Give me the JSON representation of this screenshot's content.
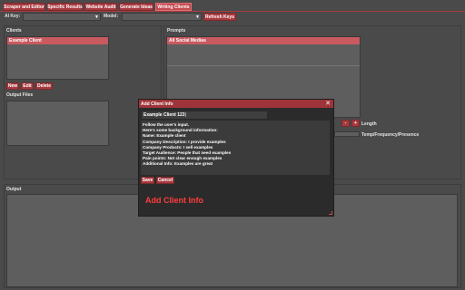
{
  "tabs": [
    "Scraper and Editor",
    "Specific Results",
    "Website Audit",
    "Generate Ideas",
    "Writing Clients"
  ],
  "topbar": {
    "ai_key_label": "AI Key:",
    "ai_key_value": "",
    "model_label": "Model:",
    "model_value": "",
    "refresh_label": "Refresh Keys"
  },
  "clients": {
    "title": "Clients",
    "items": [
      "Example Client"
    ],
    "new_label": "New",
    "edit_label": "Edit",
    "delete_label": "Delete"
  },
  "output_files": {
    "title": "Output Files"
  },
  "prompts": {
    "title": "Prompts",
    "items": [
      "All Social Medias"
    ],
    "minus_label": "-",
    "plus_label": "+",
    "length_label": "Length",
    "temp_label": "Temp/Frequency/Presence"
  },
  "output": {
    "title": "Output"
  },
  "dialog": {
    "title": "Add Client Info",
    "close": "✕",
    "name_value": "Example Client 123",
    "body_lines": [
      "Follow the user's input.",
      "Here's some background information:",
      "Name: Example client",
      "Company Description: I provide examples",
      "Company Products: I sell examples",
      "Target Audience: People that need examples",
      "Pain points: Not clear enough examples",
      "Additional Info: Examples are great"
    ],
    "save_label": "Save",
    "cancel_label": "Cancel",
    "annotation": "Add Client Info"
  },
  "colors": {
    "accent": "#a83a3f",
    "selection": "#c85a60",
    "annotation": "#ff3d3d"
  }
}
